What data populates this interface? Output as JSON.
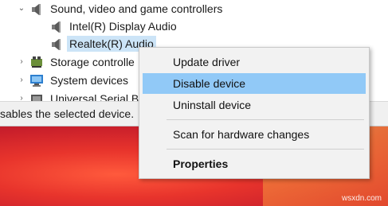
{
  "tree": {
    "category": {
      "label": "Sound, video and game controllers",
      "expander": "⌄"
    },
    "children": [
      {
        "label": "Intel(R) Display Audio"
      },
      {
        "label": "Realtek(R) Audio",
        "selected": true
      }
    ],
    "siblings": [
      {
        "label": "Storage controlle",
        "expander": "›"
      },
      {
        "label": "System devices",
        "expander": "›"
      },
      {
        "label": "Universal Serial B",
        "expander": "›"
      }
    ]
  },
  "status": {
    "text": "sables the selected device."
  },
  "menu": {
    "items": [
      {
        "label": "Update driver"
      },
      {
        "label": "Disable device",
        "highlighted": true
      },
      {
        "label": "Uninstall device"
      },
      {
        "label": "Scan for hardware changes"
      },
      {
        "label": "Properties",
        "bold": true
      }
    ]
  },
  "watermark": "wsxdn.com",
  "colors": {
    "selection": "#cce4f7",
    "menu_highlight": "#91c9f7",
    "menu_bg": "#f2f2f2"
  }
}
